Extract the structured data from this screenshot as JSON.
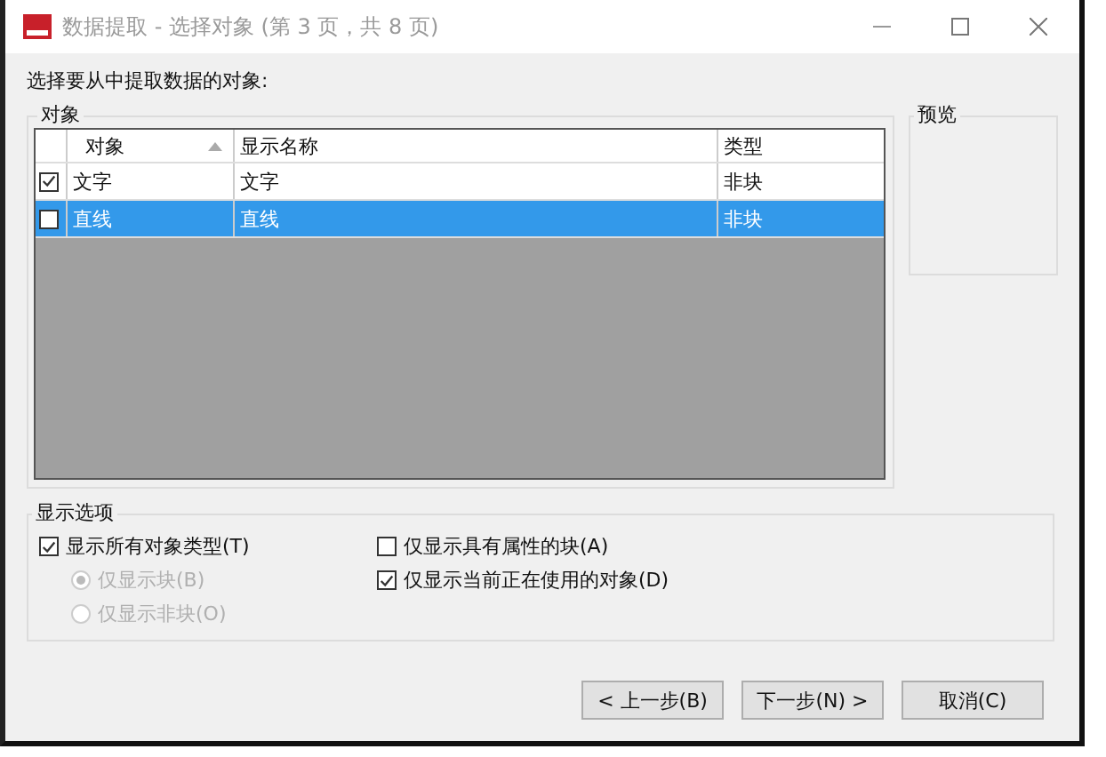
{
  "window": {
    "title": "数据提取 - 选择对象 (第 3 页，共 8 页)"
  },
  "instruction": "选择要从中提取数据的对象:",
  "objects_group": {
    "title": "对象"
  },
  "table": {
    "columns": [
      {
        "label": "对象",
        "sorted": true
      },
      {
        "label": "显示名称",
        "sorted": false
      },
      {
        "label": "类型",
        "sorted": false
      }
    ],
    "rows": [
      {
        "checked": true,
        "selected": false,
        "cells": [
          "文字",
          "文字",
          "非块"
        ]
      },
      {
        "checked": false,
        "selected": true,
        "cells": [
          "直线",
          "直线",
          "非块"
        ]
      }
    ]
  },
  "preview_group": {
    "title": "预览"
  },
  "options_group": {
    "title": "显示选项"
  },
  "options_left": [
    {
      "kind": "checkbox",
      "label": "显示所有对象类型(T)",
      "checked": true,
      "disabled": false
    },
    {
      "kind": "radio",
      "label": "仅显示块(B)",
      "selected": true,
      "disabled": true
    },
    {
      "kind": "radio",
      "label": "仅显示非块(O)",
      "selected": false,
      "disabled": true
    }
  ],
  "options_right": [
    {
      "kind": "checkbox",
      "label": "仅显示具有属性的块(A)",
      "checked": false,
      "disabled": false
    },
    {
      "kind": "checkbox",
      "label": "仅显示当前正在使用的对象(D)",
      "checked": true,
      "disabled": false
    }
  ],
  "buttons": [
    "< 上一步(B)",
    "下一步(N) >",
    "取消(C)"
  ]
}
